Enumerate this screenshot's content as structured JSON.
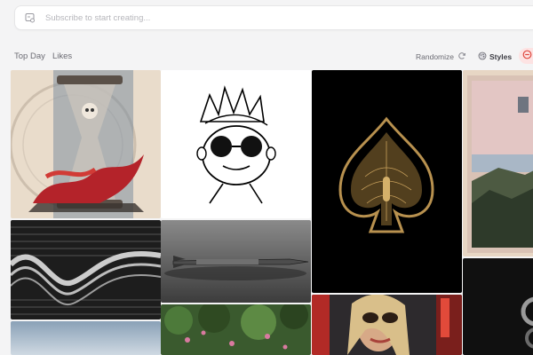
{
  "search": {
    "placeholder": "Subscribe to start creating..."
  },
  "tabs": [
    {
      "label": "Top Day"
    },
    {
      "label": "Likes"
    }
  ],
  "toolbar": {
    "randomize_label": "Randomize",
    "styles_label": "Styles"
  },
  "colors": {
    "accent": "#e0473e",
    "background": "#f4f4f5"
  },
  "icons": {
    "search": "image-search-icon",
    "randomize": "refresh-icon",
    "styles": "palette-icon",
    "filter": "circle-minus-icon"
  },
  "gallery": [
    {
      "name": "hourglass-skull-art"
    },
    {
      "name": "doodle-face-sunglasses"
    },
    {
      "name": "golden-ornate-spade"
    },
    {
      "name": "vintage-mountain-painting"
    },
    {
      "name": "glitch-wave-lines"
    },
    {
      "name": "metal-missile-render"
    },
    {
      "name": "dark-black-texture"
    },
    {
      "name": "sky-gradient"
    },
    {
      "name": "tree-flowers-garden"
    },
    {
      "name": "woman-sunglasses-neon-city"
    }
  ]
}
